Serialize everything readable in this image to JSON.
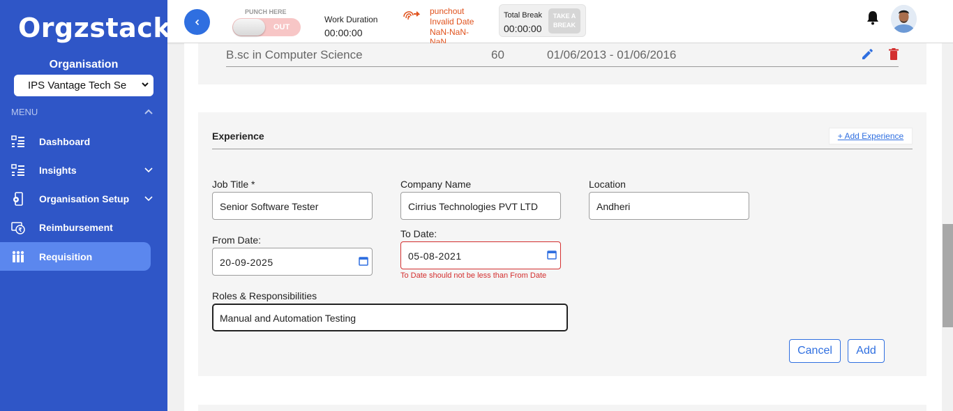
{
  "sidebar": {
    "logo": "Orgzstack",
    "org_label": "Organisation",
    "org_select_value": "IPS Vantage Tech Se",
    "menu_header": "MENU",
    "items": [
      {
        "label": "Dashboard",
        "icon": "list-icon",
        "has_children": false
      },
      {
        "label": "Insights",
        "icon": "list-icon",
        "has_children": true
      },
      {
        "label": "Organisation Setup",
        "icon": "device-gear-icon",
        "has_children": true
      },
      {
        "label": "Reimbursement",
        "icon": "money-shield-icon",
        "has_children": false
      },
      {
        "label": "Requisition",
        "icon": "people-icon",
        "has_children": false,
        "active": true
      }
    ]
  },
  "topbar": {
    "back_icon": "chevron-left-icon",
    "punch_here": "PUNCH HERE",
    "punch_toggle_label": "OUT",
    "work_duration_label": "Work Duration",
    "work_duration_value": "00:00:00",
    "punch_status_line1": "punchout",
    "punch_status_line2": "Invalid Date",
    "punch_status_line3": "NaN-NaN-",
    "punch_status_line4": "NaN",
    "total_break_label": "Total Break",
    "total_break_value": "00:00:00",
    "take_break_line1": "TAKE A",
    "take_break_line2": "BREAK"
  },
  "education": {
    "degree": "B.sc in Computer Science",
    "score": "60",
    "dates": "01/06/2013 - 01/06/2016"
  },
  "experience": {
    "title": "Experience",
    "add_link": "+ Add Experience",
    "job_title_label": "Job Title *",
    "job_title_value": "Senior Software Tester",
    "company_label": "Company Name",
    "company_value": "Cirrius Technologies PVT LTD",
    "location_label": "Location",
    "location_value": "Andheri",
    "from_date_label": "From Date:",
    "from_date_value": "20-09-2025",
    "to_date_label": "To Date:",
    "to_date_value": "05-08-2021",
    "to_date_error": "To Date should not be less than From Date",
    "roles_label": "Roles & Responsibilities",
    "roles_value": "Manual and Automation Testing",
    "cancel_label": "Cancel",
    "add_label": "Add"
  },
  "colors": {
    "sidebar_bg": "#2f56c7",
    "active_item": "#5b87ee",
    "accent": "#2f6fe0",
    "error": "#d32f2f",
    "punch_status": "#e0521d"
  }
}
